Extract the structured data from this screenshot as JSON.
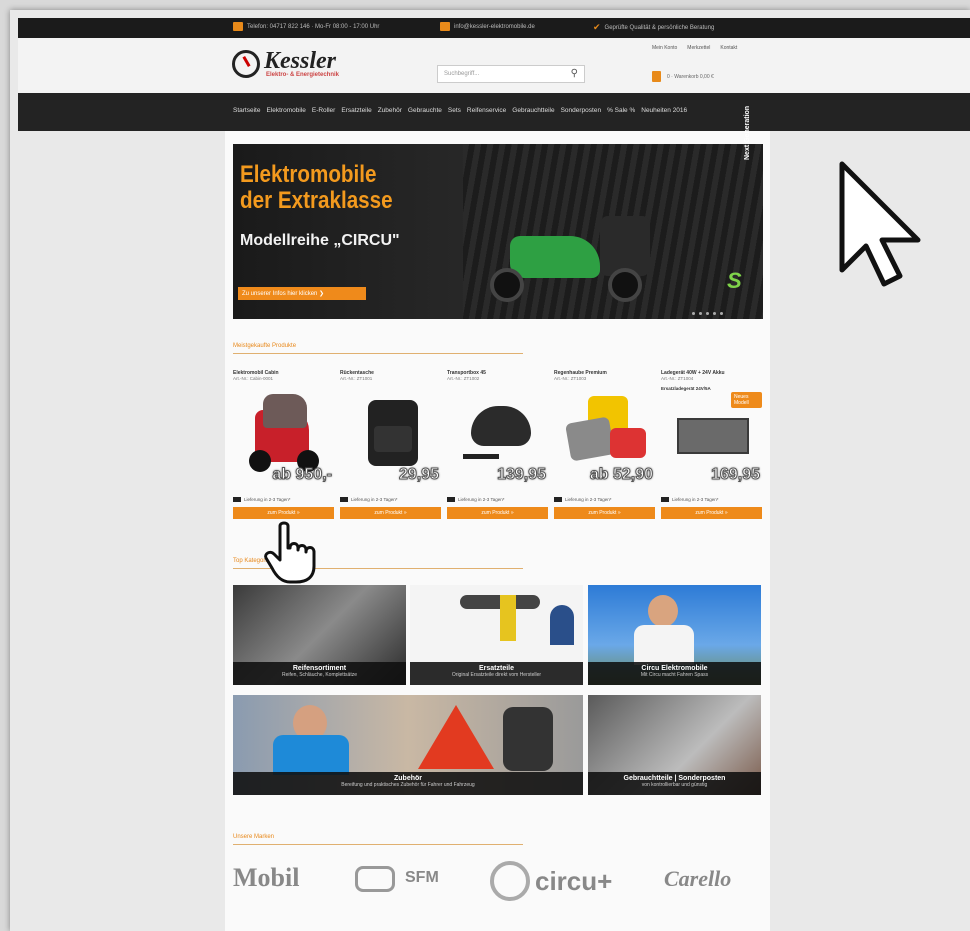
{
  "topbar": {
    "phone": "Telefon: 04717 822 146 · Mo-Fr 08:00 - 17:00 Uhr",
    "email": "info@kessler-elektromobile.de",
    "trust": "Geprüfte Qualität & persönliche Beratung"
  },
  "header": {
    "logo_name": "Kessler",
    "logo_sub": "Elektro- & Energietechnik",
    "search_placeholder": "Suchbegriff...",
    "links": [
      "Mein Konto",
      "Merkzettel",
      "Kontakt"
    ],
    "cart": "0 · Warenkorb 0,00 €"
  },
  "nav": {
    "items": [
      "Startseite",
      "Elektromobile",
      "E-Roller",
      "Ersatzteile",
      "Zubehör",
      "Gebrauchte",
      "Sets",
      "Reifenservice",
      "Gebrauchtteile",
      "Sonderposten",
      "% Sale %",
      "Neuheiten 2016"
    ]
  },
  "banner": {
    "title_line1": "Elektromobile",
    "title_line2": "der Extraklasse",
    "subtitle": "Modellreihe „CIRCU\"",
    "cta": "Zu unserer Infos hier klicken ❯",
    "vertical": "Next Generation",
    "mark": "S",
    "colors": {
      "accent": "#f39a1e",
      "scooter": "#2ea043"
    }
  },
  "sections": {
    "featured": "Meistgekaufte Produkte",
    "categories": "Top Kategorien",
    "brands": "Unsere Marken"
  },
  "products": [
    {
      "name": "Elektromobil Cabin",
      "art": "Art.-Nr.: Cabin-0001",
      "price": "ab 950,-",
      "delivery": "Lieferung in 2-3 Tagen*",
      "button": "zum Produkt »"
    },
    {
      "name": "Rückentasche",
      "art": "Art.-Nr.: ZT1001",
      "price": "29,95",
      "delivery": "Lieferung in 2-3 Tagen*",
      "button": "zum Produkt »"
    },
    {
      "name": "Transportbox 45",
      "art": "Art.-Nr.: ZT1002",
      "price": "139,95",
      "delivery": "Lieferung in 2-3 Tagen*",
      "button": "zum Produkt »"
    },
    {
      "name": "Regenhaube Premium",
      "art": "Art.-Nr.: ZT1003",
      "price": "ab 52,90",
      "delivery": "Lieferung in 2-3 Tagen*",
      "button": "zum Produkt »"
    },
    {
      "name": "Ladegerät 40W + 24V Akku",
      "art": "Art.-Nr.: ZT1004",
      "extra": "Ersatzladegerät 24V/5A",
      "badge": "Neues Modell",
      "price": "169,95",
      "delivery": "Lieferung in 2-3 Tagen*",
      "button": "zum Produkt »"
    }
  ],
  "categories": [
    {
      "title": "Reifensortiment",
      "desc": "Reifen, Schläuche, Komplettsätze"
    },
    {
      "title": "Ersatzteile",
      "desc": "Original Ersatzteile direkt vom Hersteller"
    },
    {
      "title": "Circu Elektromobile",
      "desc": "Mit Circu macht Fahren Spass"
    },
    {
      "title": "Zubehör",
      "desc": "Bereifung und praktisches Zubehör für Fahrer und Fahrzeug"
    },
    {
      "title": "Gebrauchtteile | Sonderposten",
      "desc": "von kontrollierbar und günstig"
    }
  ],
  "brands": [
    "Mobil",
    "SFM",
    "circu+",
    "Carello"
  ]
}
